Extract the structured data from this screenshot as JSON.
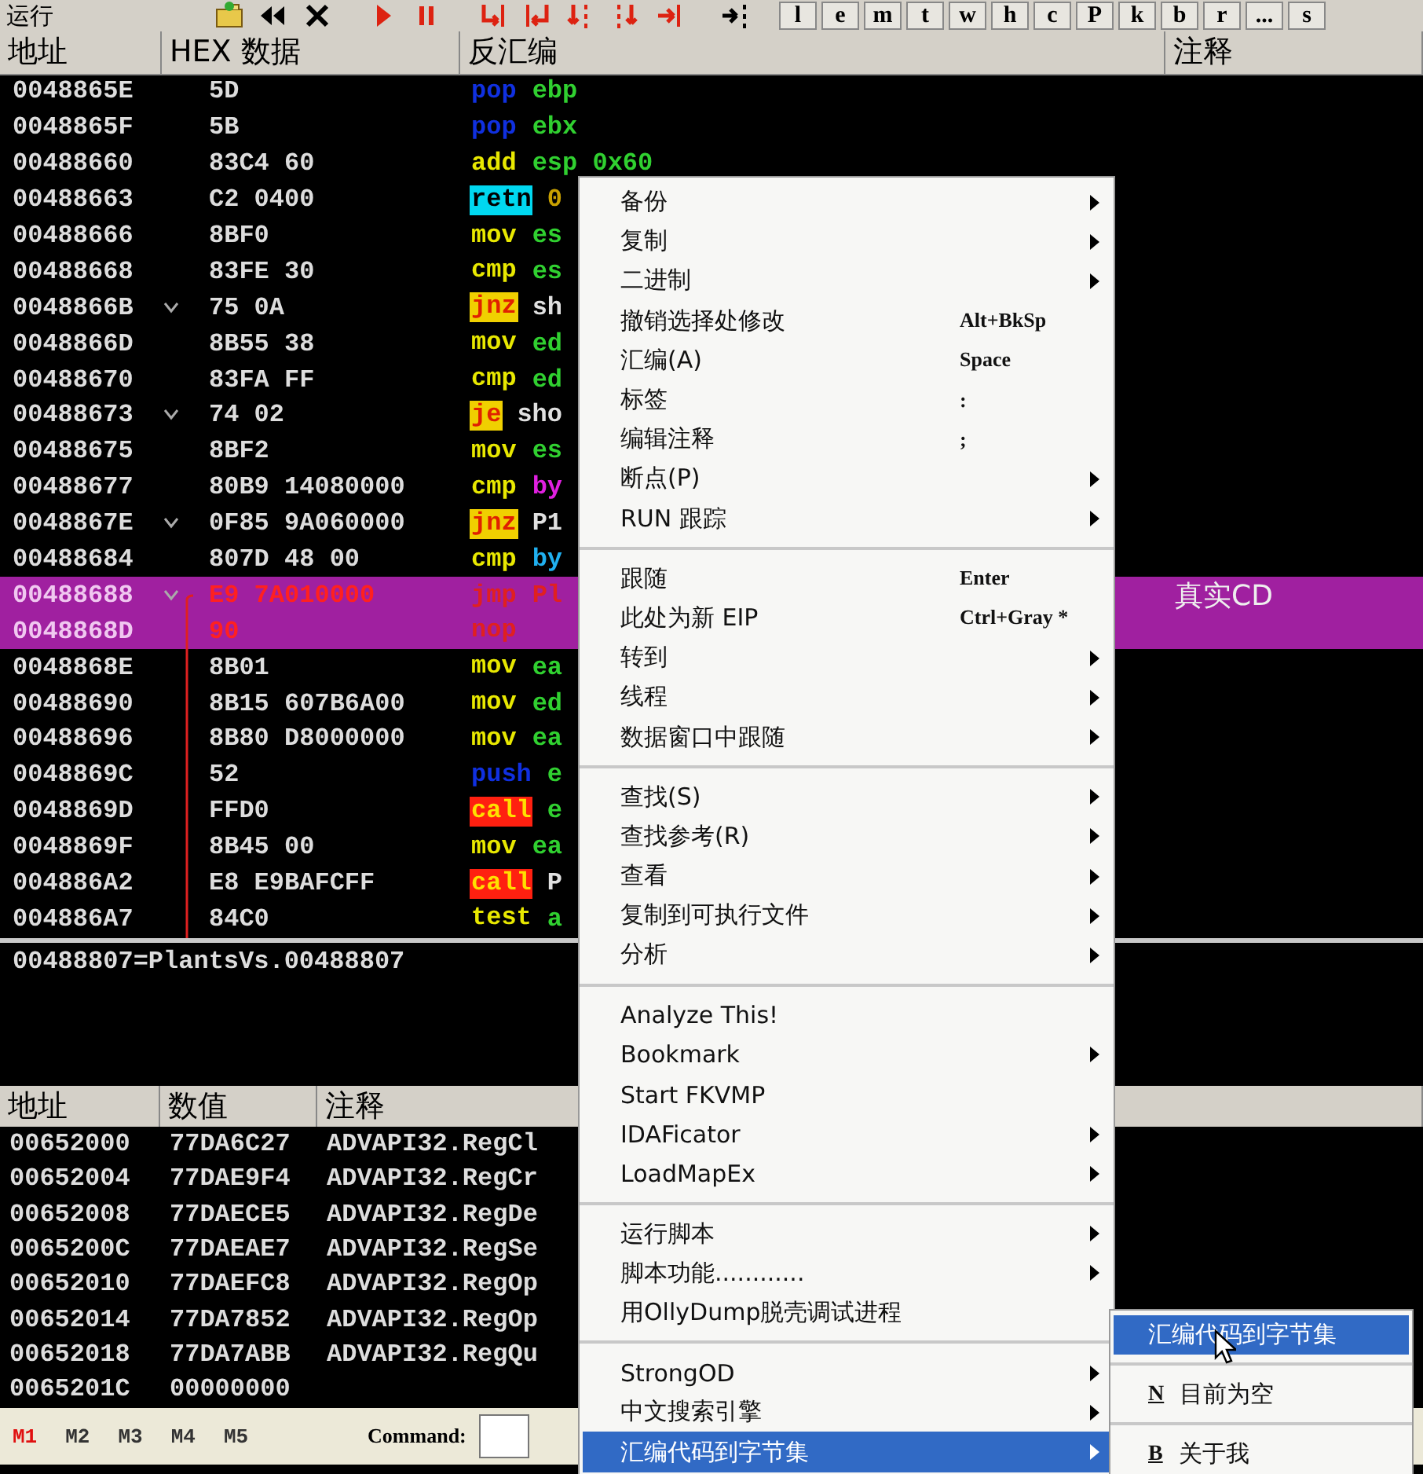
{
  "toolbar": {
    "status": "运行",
    "letter_buttons": [
      "l",
      "e",
      "m",
      "t",
      "w",
      "h",
      "c",
      "P",
      "k",
      "b",
      "r",
      "...",
      "s"
    ]
  },
  "disasm": {
    "columns": [
      "地址",
      "HEX 数据",
      "反汇编",
      "注释"
    ],
    "rows": [
      {
        "address": "0048865E",
        "hex": "5D",
        "jump_mark": false,
        "mnemonic": "pop",
        "kind": "stack",
        "operand": {
          "text": "ebp",
          "kind": "register"
        },
        "selected": false
      },
      {
        "address": "0048865F",
        "hex": "5B",
        "jump_mark": false,
        "mnemonic": "pop",
        "kind": "stack",
        "operand": {
          "text": "ebx",
          "kind": "register"
        },
        "selected": false
      },
      {
        "address": "00488660",
        "hex": "83C4 60",
        "jump_mark": false,
        "mnemonic": "add",
        "kind": "plain",
        "operand": {
          "text": "esp 0x60",
          "kind": "register"
        },
        "selected": false
      },
      {
        "address": "00488663",
        "hex": "C2 0400",
        "jump_mark": false,
        "mnemonic": "retn",
        "kind": "return",
        "operand": {
          "text": "0",
          "kind": "constant"
        },
        "selected": false
      },
      {
        "address": "00488666",
        "hex": "8BF0",
        "jump_mark": false,
        "mnemonic": "mov",
        "kind": "plain",
        "operand": {
          "text": "es",
          "kind": "register"
        },
        "selected": false
      },
      {
        "address": "00488668",
        "hex": "83FE 30",
        "jump_mark": false,
        "mnemonic": "cmp",
        "kind": "plain",
        "operand": {
          "text": "es",
          "kind": "register"
        },
        "selected": false
      },
      {
        "address": "0048866B",
        "hex": "75 0A",
        "jump_mark": true,
        "mnemonic": "jnz",
        "kind": "cond-jump",
        "operand": {
          "text": "sh",
          "kind": "label"
        },
        "selected": false
      },
      {
        "address": "0048866D",
        "hex": "8B55 38",
        "jump_mark": false,
        "mnemonic": "mov",
        "kind": "plain",
        "operand": {
          "text": "ed",
          "kind": "register"
        },
        "selected": false
      },
      {
        "address": "00488670",
        "hex": "83FA FF",
        "jump_mark": false,
        "mnemonic": "cmp",
        "kind": "plain",
        "operand": {
          "text": "ed",
          "kind": "register"
        },
        "selected": false
      },
      {
        "address": "00488673",
        "hex": "74 02",
        "jump_mark": true,
        "mnemonic": "je",
        "kind": "cond-jump",
        "operand": {
          "text": "sho",
          "kind": "label"
        },
        "selected": false
      },
      {
        "address": "00488675",
        "hex": "8BF2",
        "jump_mark": false,
        "mnemonic": "mov",
        "kind": "plain",
        "operand": {
          "text": "es",
          "kind": "register"
        },
        "selected": false
      },
      {
        "address": "00488677",
        "hex": "80B9 14080000",
        "jump_mark": false,
        "mnemonic": "cmp",
        "kind": "plain",
        "operand": {
          "text": "by",
          "kind": "memory"
        },
        "selected": false
      },
      {
        "address": "0048867E",
        "hex": "0F85 9A060000",
        "jump_mark": true,
        "mnemonic": "jnz",
        "kind": "cond-jump",
        "operand": {
          "text": "P1",
          "kind": "label"
        },
        "selected": false
      },
      {
        "address": "00488684",
        "hex": "807D 48 00",
        "jump_mark": false,
        "mnemonic": "cmp",
        "kind": "plain",
        "operand": {
          "text": "by",
          "kind": "stack-memory"
        },
        "selected": false
      },
      {
        "address": "00488688",
        "hex": "E9 7A010000",
        "jump_mark": true,
        "mnemonic": "jmp",
        "kind": "jump",
        "operand": {
          "text": "Pl",
          "kind": "label"
        },
        "selected": true,
        "comment": "真实CD"
      },
      {
        "address": "0048868D",
        "hex": "90",
        "jump_mark": false,
        "mnemonic": "nop",
        "kind": "nop",
        "selected": true
      },
      {
        "address": "0048868E",
        "hex": "8B01",
        "jump_mark": false,
        "mnemonic": "mov",
        "kind": "plain",
        "operand": {
          "text": "ea",
          "kind": "register"
        },
        "selected": false
      },
      {
        "address": "00488690",
        "hex": "8B15 607B6A00",
        "jump_mark": false,
        "mnemonic": "mov",
        "kind": "plain",
        "operand": {
          "text": "ed",
          "kind": "register"
        },
        "selected": false
      },
      {
        "address": "00488696",
        "hex": "8B80 D8000000",
        "jump_mark": false,
        "mnemonic": "mov",
        "kind": "plain",
        "operand": {
          "text": "ea",
          "kind": "register"
        },
        "selected": false
      },
      {
        "address": "0048869C",
        "hex": "52",
        "jump_mark": false,
        "mnemonic": "push",
        "kind": "stack",
        "operand": {
          "text": "e",
          "kind": "register"
        },
        "selected": false
      },
      {
        "address": "0048869D",
        "hex": "FFD0",
        "jump_mark": false,
        "mnemonic": "call",
        "kind": "call",
        "operand": {
          "text": "e",
          "kind": "register"
        },
        "selected": false
      },
      {
        "address": "0048869F",
        "hex": "8B45 00",
        "jump_mark": false,
        "mnemonic": "mov",
        "kind": "plain",
        "operand": {
          "text": "ea",
          "kind": "register"
        },
        "selected": false
      },
      {
        "address": "004886A2",
        "hex": "E8 E9BAFCFF",
        "jump_mark": false,
        "mnemonic": "call",
        "kind": "call",
        "operand": {
          "text": "P",
          "kind": "label"
        },
        "selected": false
      },
      {
        "address": "004886A7",
        "hex": "84C0",
        "jump_mark": false,
        "mnemonic": "test",
        "kind": "plain",
        "operand": {
          "text": "a",
          "kind": "register"
        },
        "selected": false
      }
    ]
  },
  "info": "00488807=PlantsVs.00488807",
  "dump": {
    "columns": [
      "地址",
      "数值",
      "注释"
    ],
    "rows": [
      {
        "address": "00652000",
        "value": "77DA6C27",
        "comment": "ADVAPI32.RegCl"
      },
      {
        "address": "00652004",
        "value": "77DAE9F4",
        "comment": "ADVAPI32.RegCr"
      },
      {
        "address": "00652008",
        "value": "77DAECE5",
        "comment": "ADVAPI32.RegDe"
      },
      {
        "address": "0065200C",
        "value": "77DAEAE7",
        "comment": "ADVAPI32.RegSe"
      },
      {
        "address": "00652010",
        "value": "77DAEFC8",
        "comment": "ADVAPI32.RegOp"
      },
      {
        "address": "00652014",
        "value": "77DA7852",
        "comment": "ADVAPI32.RegOp"
      },
      {
        "address": "00652018",
        "value": "77DA7ABB",
        "comment": "ADVAPI32.RegQu"
      },
      {
        "address": "0065201C",
        "value": "00000000"
      }
    ]
  },
  "status_bar": {
    "memory_tabs": [
      {
        "label": "M1",
        "selected": true
      },
      {
        "label": "M2",
        "selected": false
      },
      {
        "label": "M3",
        "selected": false
      },
      {
        "label": "M4",
        "selected": false
      },
      {
        "label": "M5",
        "selected": false
      }
    ],
    "command_label": "Command:"
  },
  "context_menu": {
    "groups": [
      [
        {
          "label": "备份",
          "submenu": true,
          "selected": false
        },
        {
          "label": "复制",
          "submenu": true,
          "selected": false
        },
        {
          "label": "二进制",
          "submenu": true,
          "selected": false
        },
        {
          "label": "撤销选择处修改",
          "shortcut": "Alt+BkSp",
          "submenu": false,
          "selected": false
        },
        {
          "label": "汇编(A)",
          "shortcut": "Space",
          "submenu": false,
          "selected": false
        },
        {
          "label": "标签",
          "shortcut": ":",
          "submenu": false,
          "selected": false
        },
        {
          "label": "编辑注释",
          "shortcut": ";",
          "submenu": false,
          "selected": false
        },
        {
          "label": "断点(P)",
          "submenu": true,
          "selected": false
        },
        {
          "label": "RUN 跟踪",
          "submenu": true,
          "selected": false
        }
      ],
      [
        {
          "label": "跟随",
          "shortcut": "Enter",
          "submenu": false,
          "selected": false
        },
        {
          "label": "此处为新 EIP",
          "shortcut": "Ctrl+Gray *",
          "submenu": false,
          "selected": false
        },
        {
          "label": "转到",
          "submenu": true,
          "selected": false
        },
        {
          "label": "线程",
          "submenu": true,
          "selected": false
        },
        {
          "label": "数据窗口中跟随",
          "submenu": true,
          "selected": false
        }
      ],
      [
        {
          "label": "查找(S)",
          "submenu": true,
          "selected": false
        },
        {
          "label": "查找参考(R)",
          "submenu": true,
          "selected": false
        },
        {
          "label": "查看",
          "submenu": true,
          "selected": false
        },
        {
          "label": "复制到可执行文件",
          "submenu": true,
          "selected": false
        },
        {
          "label": "分析",
          "submenu": true,
          "selected": false
        }
      ],
      [
        {
          "label": "Analyze This!",
          "submenu": false,
          "selected": false
        },
        {
          "label": "Bookmark",
          "submenu": true,
          "selected": false
        },
        {
          "label": "Start FKVMP",
          "submenu": false,
          "selected": false
        },
        {
          "label": "IDAFicator",
          "submenu": true,
          "selected": false
        },
        {
          "label": "LoadMapEx",
          "submenu": true,
          "selected": false
        }
      ],
      [
        {
          "label": "运行脚本",
          "submenu": true,
          "selected": false
        },
        {
          "label": "脚本功能............",
          "submenu": true,
          "selected": false
        },
        {
          "label": "用OllyDump脱壳调试进程",
          "submenu": false,
          "selected": false
        }
      ],
      [
        {
          "label": "StrongOD",
          "submenu": true,
          "selected": false
        },
        {
          "label": "中文搜索引擎",
          "submenu": true,
          "selected": false
        },
        {
          "label": "汇编代码到字节集",
          "submenu": true,
          "selected": true
        }
      ]
    ]
  },
  "submenu": {
    "groups": [
      [
        {
          "label": "汇编代码到字节集",
          "selected": true
        }
      ],
      [
        {
          "key": "N",
          "label": "目前为空",
          "selected": false
        }
      ],
      [
        {
          "key": "B",
          "label": "关于我",
          "selected": false
        }
      ]
    ]
  }
}
